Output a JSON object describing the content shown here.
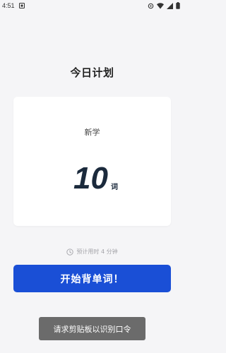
{
  "status_bar": {
    "time": "4:51",
    "icons": [
      "notification-icon",
      "settings-icon",
      "wifi-icon",
      "signal-icon",
      "battery-icon"
    ]
  },
  "page": {
    "title": "今日计划"
  },
  "plan_card": {
    "label": "新学",
    "count": "10",
    "unit": "词"
  },
  "estimate": {
    "icon": "clock-icon",
    "text": "预计用时 4 分钟"
  },
  "start_button": {
    "label": "开始背单词！"
  },
  "toast": {
    "text": "请求剪贴板以识别口令"
  },
  "colors": {
    "background": "#f5f5f7",
    "card": "#ffffff",
    "primary": "#1a4fd6",
    "count_text": "#1b2a3c",
    "toast_bg": "#6b6b6b"
  }
}
